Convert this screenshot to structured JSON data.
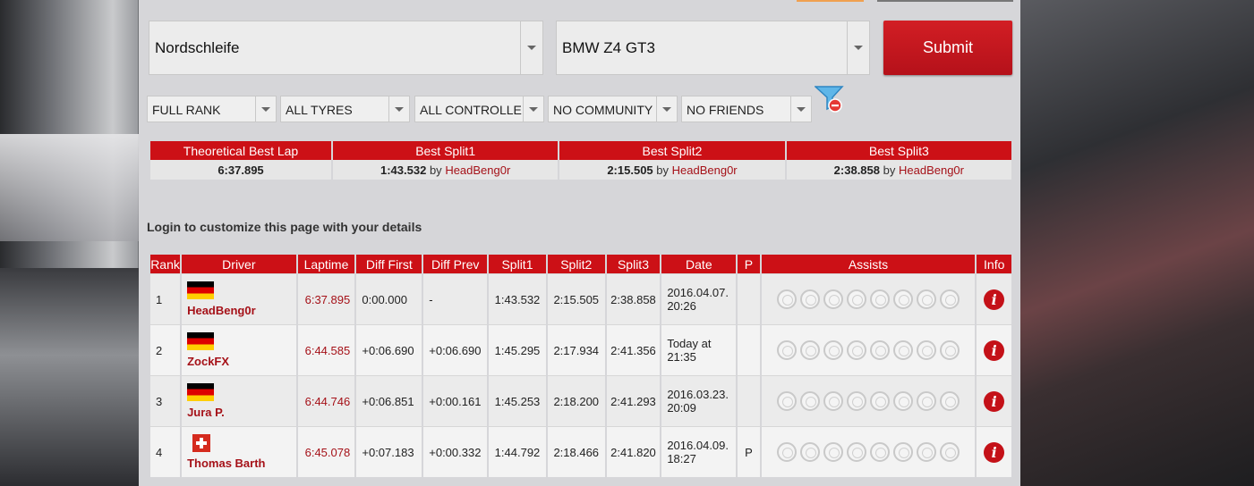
{
  "selectors": {
    "track": "Nordschleife",
    "car": "BMW Z4 GT3",
    "submit_label": "Submit"
  },
  "filters": [
    {
      "value": "FULL RANK"
    },
    {
      "value": "ALL TYRES"
    },
    {
      "value": "ALL CONTROLLERS"
    },
    {
      "value": "NO COMMUNITY"
    },
    {
      "value": "NO FRIENDS"
    }
  ],
  "splits": {
    "headers": [
      "Theoretical Best Lap",
      "Best Split1",
      "Best Split2",
      "Best Split3"
    ],
    "theoretical": "6:37.895",
    "by_label": "by",
    "values": [
      {
        "time": "1:43.532",
        "driver": "HeadBeng0r"
      },
      {
        "time": "2:15.505",
        "driver": "HeadBeng0r"
      },
      {
        "time": "2:38.858",
        "driver": "HeadBeng0r"
      }
    ]
  },
  "login_text": "Login to customize this page with your details",
  "leaderboard": {
    "columns": [
      "Rank",
      "Driver",
      "Laptime",
      "Diff First",
      "Diff Prev",
      "Split1",
      "Split2",
      "Split3",
      "Date",
      "P",
      "Assists",
      "Info"
    ],
    "rows": [
      {
        "rank": "1",
        "flag": "de",
        "driver": "HeadBeng0r",
        "laptime": "6:37.895",
        "diff_first": "0:00.000",
        "diff_prev": "-",
        "split1": "1:43.532",
        "split2": "2:15.505",
        "split3": "2:38.858",
        "date1": "2016.04.07.",
        "date2": "20:26",
        "p": ""
      },
      {
        "rank": "2",
        "flag": "de",
        "driver": "ZockFX",
        "laptime": "6:44.585",
        "diff_first": "+0:06.690",
        "diff_prev": "+0:06.690",
        "split1": "1:45.295",
        "split2": "2:17.934",
        "split3": "2:41.356",
        "date1": "Today at",
        "date2": "21:35",
        "p": ""
      },
      {
        "rank": "3",
        "flag": "de",
        "driver": "Jura P.",
        "laptime": "6:44.746",
        "diff_first": "+0:06.851",
        "diff_prev": "+0:00.161",
        "split1": "1:45.253",
        "split2": "2:18.200",
        "split3": "2:41.293",
        "date1": "2016.03.23.",
        "date2": "20:09",
        "p": ""
      },
      {
        "rank": "4",
        "flag": "ch",
        "driver": "Thomas Barth",
        "laptime": "6:45.078",
        "diff_first": "+0:07.183",
        "diff_prev": "+0:00.332",
        "split1": "1:44.792",
        "split2": "2:18.466",
        "split3": "2:41.820",
        "date1": "2016.04.09.",
        "date2": "18:27",
        "p": "P"
      }
    ],
    "assist_icons": [
      "abs-icon",
      "tc-icon",
      "sc-icon",
      "gearbox-icon",
      "clutch-icon",
      "braking-line-icon",
      "ideal-line-icon",
      "auto-brake-icon"
    ],
    "info_glyph": "i"
  }
}
